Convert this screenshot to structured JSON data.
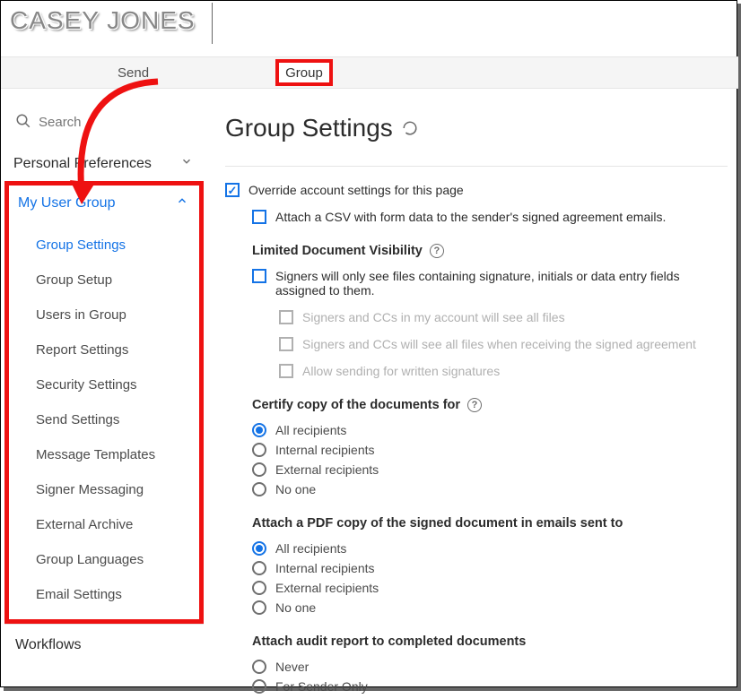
{
  "brand": "CASEY JONES",
  "tabs": {
    "send": "Send",
    "group": "Group"
  },
  "search": {
    "placeholder": "Search"
  },
  "sidebar": {
    "personal": "Personal Preferences",
    "my_group": "My User Group",
    "items": [
      "Group Settings",
      "Group Setup",
      "Users in Group",
      "Report Settings",
      "Security Settings",
      "Send Settings",
      "Message Templates",
      "Signer Messaging",
      "External Archive",
      "Group Languages",
      "Email Settings"
    ],
    "workflows": "Workflows"
  },
  "page": {
    "title": "Group Settings",
    "override": "Override account settings for this page",
    "attach_csv": "Attach a CSV with form data to the sender's signed agreement emails.",
    "ldv": {
      "head": "Limited Document Visibility",
      "main": "Signers will only see files containing signature, initials or data entry fields assigned to them.",
      "sub1": "Signers and CCs in my account will see all files",
      "sub2": "Signers and CCs will see all files when receiving the signed agreement",
      "sub3": "Allow sending for written signatures"
    },
    "certify": {
      "head": "Certify copy of the documents for",
      "opts": [
        "All recipients",
        "Internal recipients",
        "External recipients",
        "No one"
      ]
    },
    "pdfcopy": {
      "head": "Attach a PDF copy of the signed document in emails sent to",
      "opts": [
        "All recipients",
        "Internal recipients",
        "External recipients",
        "No one"
      ]
    },
    "audit": {
      "head": "Attach audit report to completed documents",
      "opts": [
        "Never",
        "For Sender Only"
      ]
    }
  }
}
